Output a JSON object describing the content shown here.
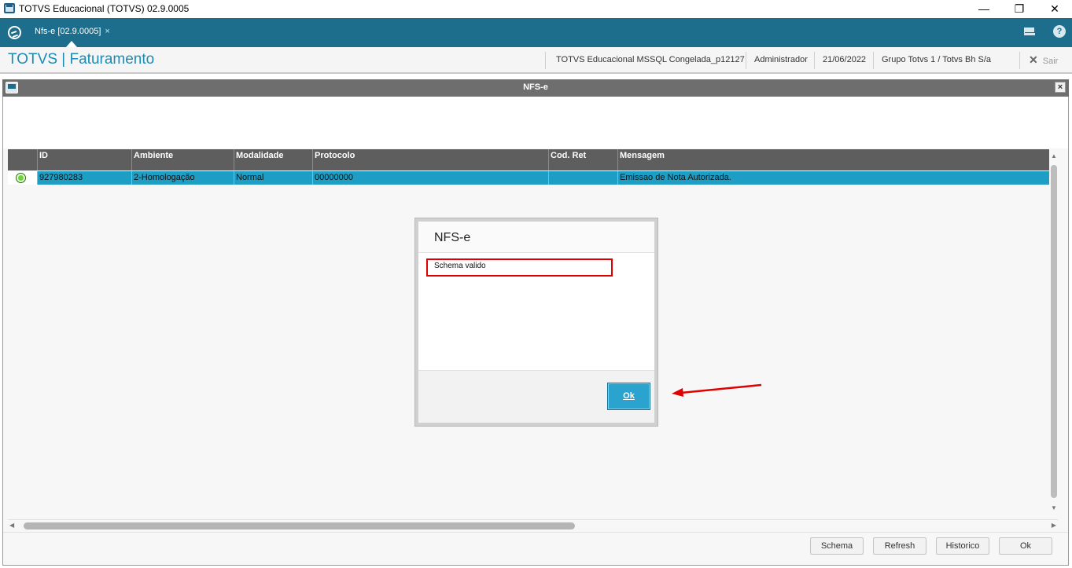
{
  "window": {
    "title": "TOTVS Educacional (TOTVS) 02.9.0005",
    "minimize_glyph": "—",
    "restore_glyph": "❐",
    "close_glyph": "✕"
  },
  "topbar": {
    "tab_label": "Nfs-e [02.9.0005]",
    "tab_close": "×",
    "help_glyph": "?"
  },
  "header": {
    "app_name": "TOTVS | Faturamento",
    "environment": "TOTVS Educacional MSSQL Congelada_p12127",
    "user": "Administrador",
    "date": "21/06/2022",
    "group": "Grupo Totvs 1 / Totvs  Bh S/a",
    "exit_label": "Sair",
    "exit_glyph": "✕"
  },
  "dialog": {
    "title": "NFS-e",
    "close_glyph": "×"
  },
  "grid": {
    "columns": [
      "ID",
      "Ambiente",
      "Modalidade",
      "Protocolo",
      "Cod. Ret",
      "Mensagem"
    ],
    "rows": [
      {
        "status": "green",
        "id": "927980283",
        "ambiente": "2-Homologação",
        "modalidade": "Normal",
        "protocolo": "00000000",
        "cod_ret": "",
        "mensagem": "Emissao de Nota Autorizada."
      }
    ]
  },
  "scroll": {
    "up": "▲",
    "down": "▼",
    "left": "◀",
    "right": "▶"
  },
  "buttons": {
    "schema": "Schema",
    "refresh": "Refresh",
    "historico": "Historico",
    "ok": "Ok"
  },
  "modal": {
    "title": "NFS-e",
    "message": "Schema valido",
    "ok_label": "Ok"
  },
  "colors": {
    "topbar": "#1c6e8c",
    "accent": "#1b8db5",
    "selected_row": "#1e9ec4",
    "highlight": "#e00000",
    "status_ok": "#6fd13d"
  },
  "icons": [
    "app-window-icon",
    "totvs-logo-icon",
    "mail-icon",
    "help-icon",
    "dialog-window-icon",
    "status-green-icon",
    "red-arrow-annotation"
  ]
}
